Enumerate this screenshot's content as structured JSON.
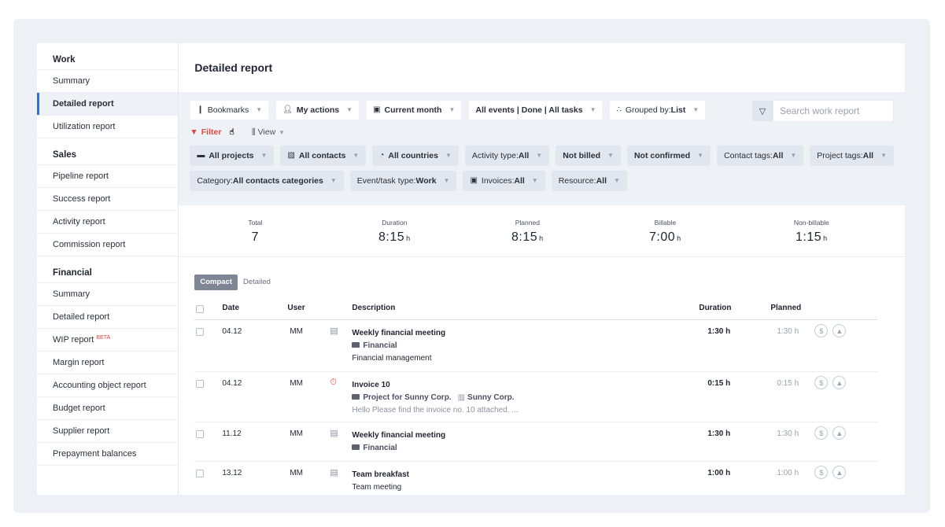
{
  "sidebar": {
    "work_heading": "Work",
    "work_items": [
      {
        "label": "Summary"
      },
      {
        "label": "Detailed report"
      },
      {
        "label": "Utilization report"
      }
    ],
    "sales_heading": "Sales",
    "sales_items": [
      {
        "label": "Pipeline report"
      },
      {
        "label": "Success report"
      },
      {
        "label": "Activity report"
      },
      {
        "label": "Commission report"
      }
    ],
    "financial_heading": "Financial",
    "financial_items": [
      {
        "label": "Summary"
      },
      {
        "label": "Detailed report"
      },
      {
        "label": "WIP report",
        "badge": "BETA"
      },
      {
        "label": "Margin report"
      },
      {
        "label": "Accounting object report"
      },
      {
        "label": "Budget report"
      },
      {
        "label": "Supplier report"
      },
      {
        "label": "Prepayment balances"
      }
    ]
  },
  "main": {
    "title": "Detailed report"
  },
  "toolbar": {
    "bookmarks": "Bookmarks",
    "my_actions": "My actions",
    "current_month": "Current month",
    "events": "All events | Done | All tasks",
    "grouped_prefix": "Grouped by: ",
    "grouped_value": "List",
    "search_placeholder": "Search work report",
    "filter": "Filter",
    "view": "View"
  },
  "filters": {
    "all_projects": "All projects",
    "all_contacts": "All contacts",
    "all_countries": "All countries",
    "activity_prefix": "Activity type: ",
    "activity_value": "All",
    "not_billed": "Not billed",
    "not_confirmed": "Not confirmed",
    "contact_tags_prefix": "Contact tags: ",
    "contact_tags_value": "All",
    "project_tags_prefix": "Project tags: ",
    "project_tags_value": "All",
    "category_prefix": "Category: ",
    "category_value": "All contacts categories",
    "event_type_prefix": "Event/task type: ",
    "event_type_value": "Work",
    "invoices_prefix": "Invoices: ",
    "invoices_value": "All",
    "resource_prefix": "Resource: ",
    "resource_value": "All"
  },
  "stats": {
    "total": {
      "label": "Total",
      "value": "7"
    },
    "duration": {
      "label": "Duration",
      "value": "8:15",
      "unit": "h"
    },
    "planned": {
      "label": "Planned",
      "value": "8:15",
      "unit": "h"
    },
    "billable": {
      "label": "Billable",
      "value": "7:00",
      "unit": "h"
    },
    "nonbillable": {
      "label": "Non-billable",
      "value": "1:15",
      "unit": "h"
    }
  },
  "table": {
    "tab_compact": "Compact",
    "tab_detailed": "Detailed",
    "headers": {
      "date": "Date",
      "user": "User",
      "description": "Description",
      "duration": "Duration",
      "planned": "Planned"
    },
    "rows": [
      {
        "date": "04.12",
        "user": "MM",
        "icon": "calendar-icon",
        "title": "Weekly financial meeting",
        "project": "Financial",
        "line2": "Financial management",
        "duration": "1:30 h",
        "planned": "1:30 h"
      },
      {
        "date": "04.12",
        "user": "MM",
        "icon": "timer-icon",
        "title": "Invoice 10",
        "project": "Project for Sunny Corp.",
        "company": "Sunny Corp.",
        "line2": "Hello  Please find the invoice no. 10 attached.  ...",
        "duration": "0:15 h",
        "planned": "0:15 h"
      },
      {
        "date": "11.12",
        "user": "MM",
        "icon": "calendar-icon",
        "title": "Weekly financial meeting",
        "project": "Financial",
        "duration": "1:30 h",
        "planned": "1:30 h"
      },
      {
        "date": "13.12",
        "user": "MM",
        "icon": "calendar-icon",
        "title": "Team breakfast",
        "line2": "Team meeting",
        "duration": "1:00 h",
        "planned": "1:00 h"
      }
    ]
  },
  "colors": {
    "accent": "#2f6fde",
    "filter_red": "#e0483e",
    "toolbar_bg": "#eef1f6"
  }
}
